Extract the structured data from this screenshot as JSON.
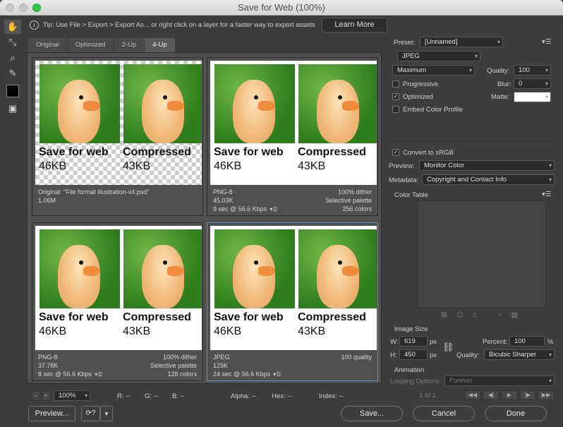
{
  "window": {
    "title": "Save for Web (100%)"
  },
  "tip": {
    "text": "Tip: Use File > Export > Export As...  or right click on a layer for a faster way to export assets",
    "learn_more": "Learn More"
  },
  "tabs": [
    "Original",
    "Optimized",
    "2-Up",
    "4-Up"
  ],
  "panes": [
    {
      "cap_a1": "Save for web",
      "cap_a2": "46KB",
      "cap_b1": "Compressed",
      "cap_b2": "43KB",
      "l1": "Original: \"File format illustration-v4.psd\"",
      "l2": "1.06M",
      "l3": "",
      "r1": "",
      "r2": "",
      "r3": ""
    },
    {
      "cap_a1": "Save for web",
      "cap_a2": "46KB",
      "cap_b1": "Compressed",
      "cap_b2": "43KB",
      "l1": "PNG-8",
      "l2": "45.03K",
      "l3": "9 sec @ 56.6 Kbps",
      "r1": "100% dither",
      "r2": "Selective palette",
      "r3": "256 colors"
    },
    {
      "cap_a1": "Save for web",
      "cap_a2": "46KB",
      "cap_b1": "Compressed",
      "cap_b2": "43KB",
      "l1": "PNG-8",
      "l2": "37.78K",
      "l3": "8 sec @ 56.6 Kbps",
      "r1": "100% dither",
      "r2": "Selective palette",
      "r3": "128 colors"
    },
    {
      "cap_a1": "Save for web",
      "cap_a2": "46KB",
      "cap_b1": "Compressed",
      "cap_b2": "43KB",
      "l1": "JPEG",
      "l2": "129K",
      "l3": "24 sec @ 56.6 Kbps",
      "r1": "100 quality",
      "r2": "",
      "r3": ""
    }
  ],
  "settings": {
    "preset_label": "Preset:",
    "preset_value": "[Unnamed]",
    "format": "JPEG",
    "compression": "Maximum",
    "quality_label": "Quality:",
    "quality": "100",
    "progressive": "Progressive",
    "blur_label": "Blur:",
    "blur": "0",
    "optimized": "Optimized",
    "matte_label": "Matte:",
    "embed_profile": "Embed Color Profile",
    "convert_srgb": "Convert to sRGB",
    "preview_label": "Preview:",
    "preview_value": "Monitor Color",
    "metadata_label": "Metadata:",
    "metadata_value": "Copyright and Contact Info",
    "color_table": "Color Table",
    "image_size": "Image Size",
    "w_label": "W:",
    "w": "619",
    "h_label": "H:",
    "h": "450",
    "px": "px",
    "percent_label": "Percent:",
    "percent": "100",
    "pct": "%",
    "quality2_label": "Quality:",
    "resample": "Bicubic Sharper",
    "animation": "Animation",
    "looping_label": "Looping Options:",
    "looping_value": "Forever",
    "frame": "1 of 1"
  },
  "status": {
    "zoom": "100%",
    "r": "R: --",
    "g": "G: --",
    "b": "B: --",
    "alpha": "Alpha: --",
    "hex": "Hex: --",
    "index": "Index: --"
  },
  "buttons": {
    "preview": "Preview...",
    "save": "Save...",
    "cancel": "Cancel",
    "done": "Done"
  }
}
